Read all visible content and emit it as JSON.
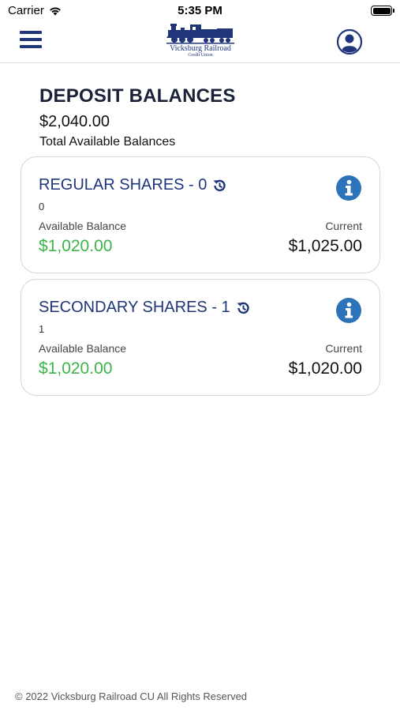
{
  "status_bar": {
    "carrier": "Carrier",
    "time": "5:35 PM"
  },
  "nav": {
    "logo_name": "Vicksburg Railroad",
    "logo_sub": "Credit Union",
    "brand_color": "#20357a"
  },
  "header": {
    "title": "DEPOSIT BALANCES",
    "total_amount": "$2,040.00",
    "total_label": "Total Available Balances"
  },
  "accounts": [
    {
      "title": "REGULAR SHARES - 0",
      "subtitle": "0",
      "available_label": "Available Balance",
      "available_value": "$1,020.00",
      "current_label": "Current",
      "current_value": "$1,025.00"
    },
    {
      "title": "SECONDARY SHARES - 1",
      "subtitle": "1",
      "available_label": "Available Balance",
      "available_value": "$1,020.00",
      "current_label": "Current",
      "current_value": "$1,020.00"
    }
  ],
  "colors": {
    "accent": "#20357a",
    "available_green": "#3bb54a",
    "info_blue": "#2d73b9"
  },
  "footer": {
    "text": "© 2022 Vicksburg Railroad CU All Rights Reserved"
  }
}
